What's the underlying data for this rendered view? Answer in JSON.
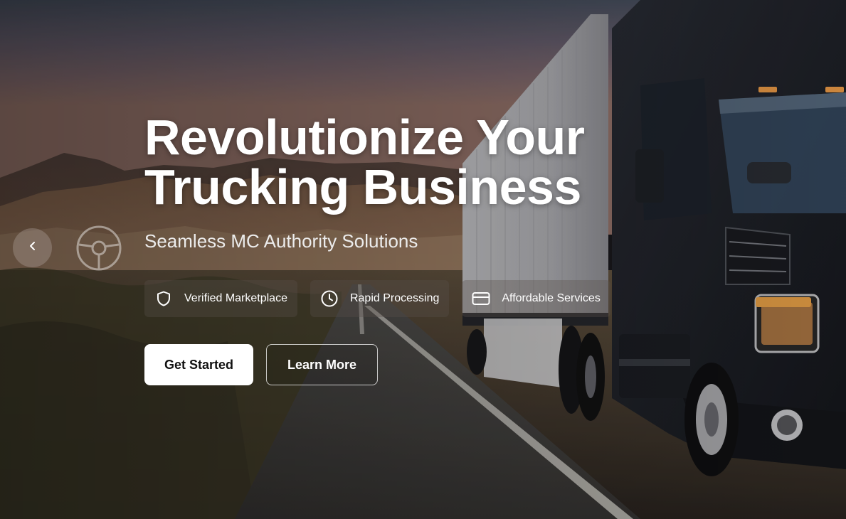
{
  "hero": {
    "title": "Revolutionize Your Trucking Business",
    "subtitle": "Seamless MC Authority Solutions",
    "features": [
      {
        "label": "Verified Marketplace",
        "icon": "shield-icon"
      },
      {
        "label": "Rapid Processing",
        "icon": "clock-icon"
      },
      {
        "label": "Affordable Services",
        "icon": "credit-card-icon"
      }
    ],
    "buttons": {
      "primary": "Get Started",
      "secondary": "Learn More"
    }
  },
  "carousel": {
    "prev_icon": "chevron-left-icon"
  },
  "colors": {
    "text": "#ffffff",
    "primary_button_bg": "#ffffff",
    "primary_button_text": "#111111"
  }
}
